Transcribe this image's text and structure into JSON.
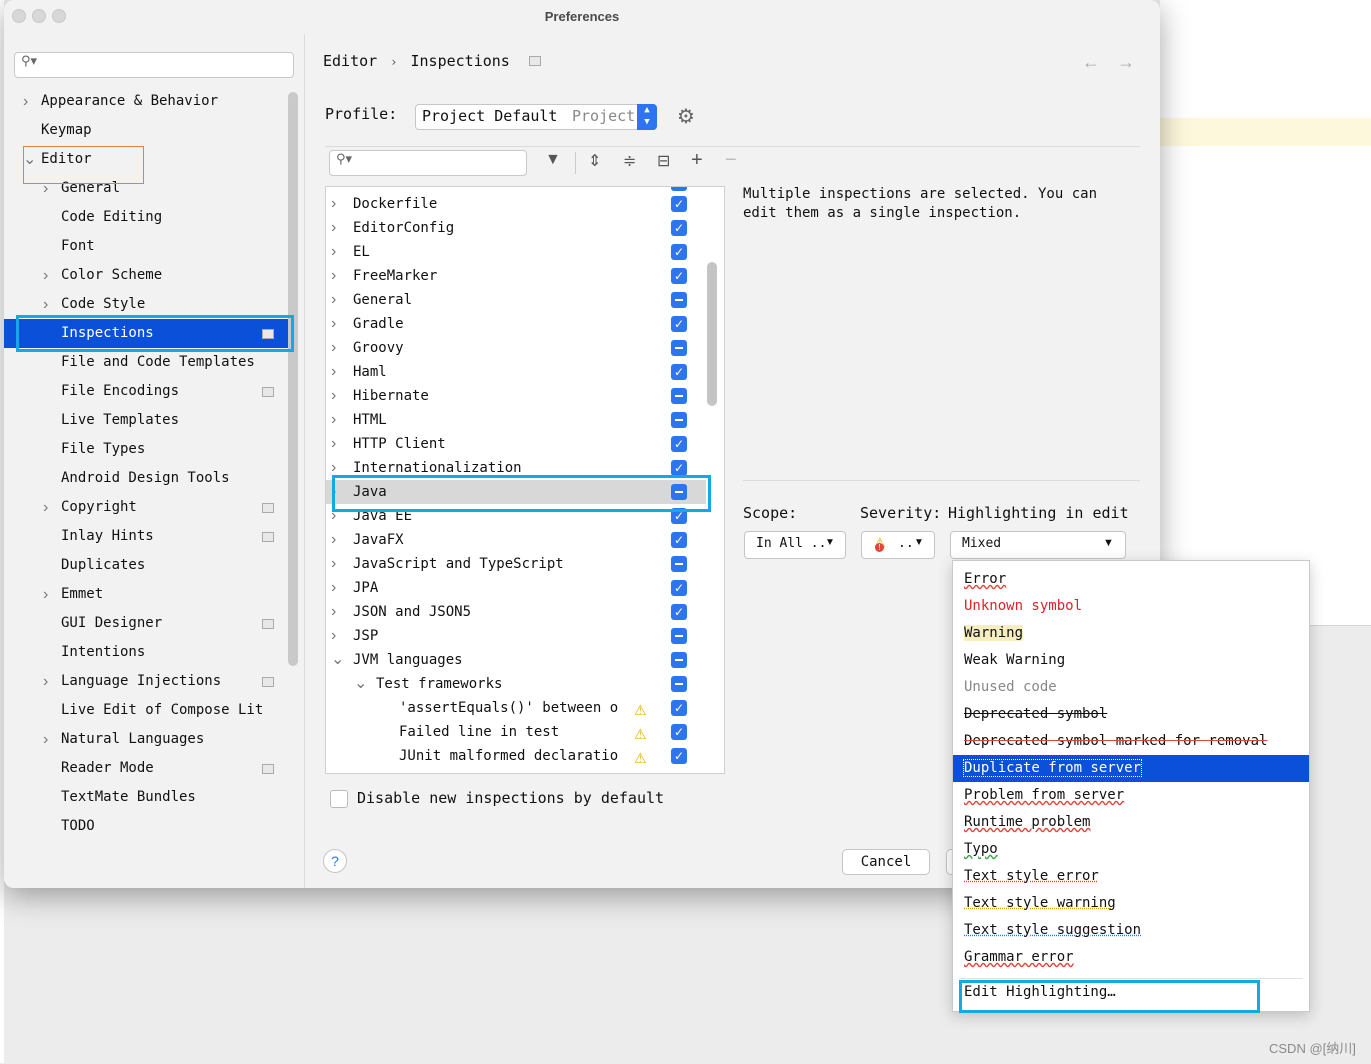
{
  "window": {
    "title": "Preferences"
  },
  "sidebar": {
    "search_placeholder": "",
    "items": [
      {
        "label": "Appearance & Behavior",
        "level": 0,
        "expandable": true
      },
      {
        "label": "Keymap",
        "level": 0,
        "expandable": false
      },
      {
        "label": "Editor",
        "level": 0,
        "expandable": true,
        "expanded": true
      },
      {
        "label": "General",
        "level": 1,
        "expandable": true
      },
      {
        "label": "Code Editing",
        "level": 1,
        "expandable": false
      },
      {
        "label": "Font",
        "level": 1,
        "expandable": false
      },
      {
        "label": "Color Scheme",
        "level": 1,
        "expandable": true
      },
      {
        "label": "Code Style",
        "level": 1,
        "expandable": true
      },
      {
        "label": "Inspections",
        "level": 1,
        "expandable": false,
        "selected": true,
        "project_icon": true
      },
      {
        "label": "File and Code Templates",
        "level": 1,
        "expandable": false
      },
      {
        "label": "File Encodings",
        "level": 1,
        "expandable": false,
        "project_icon": true
      },
      {
        "label": "Live Templates",
        "level": 1,
        "expandable": false
      },
      {
        "label": "File Types",
        "level": 1,
        "expandable": false
      },
      {
        "label": "Android Design Tools",
        "level": 1,
        "expandable": false
      },
      {
        "label": "Copyright",
        "level": 1,
        "expandable": true,
        "project_icon": true
      },
      {
        "label": "Inlay Hints",
        "level": 1,
        "expandable": false,
        "project_icon": true
      },
      {
        "label": "Duplicates",
        "level": 1,
        "expandable": false
      },
      {
        "label": "Emmet",
        "level": 1,
        "expandable": true
      },
      {
        "label": "GUI Designer",
        "level": 1,
        "expandable": false,
        "project_icon": true
      },
      {
        "label": "Intentions",
        "level": 1,
        "expandable": false
      },
      {
        "label": "Language Injections",
        "level": 1,
        "expandable": true,
        "project_icon": true
      },
      {
        "label": "Live Edit of Compose Lit",
        "level": 1,
        "expandable": false
      },
      {
        "label": "Natural Languages",
        "level": 1,
        "expandable": true
      },
      {
        "label": "Reader Mode",
        "level": 1,
        "expandable": false,
        "project_icon": true
      },
      {
        "label": "TextMate Bundles",
        "level": 1,
        "expandable": false
      },
      {
        "label": "TODO",
        "level": 1,
        "expandable": false
      }
    ]
  },
  "breadcrumb": {
    "part1": "Editor",
    "separator": "›",
    "part2": "Inspections"
  },
  "profile": {
    "label": "Profile:",
    "value": "Project Default",
    "scope_hint": "Project"
  },
  "inspections": [
    {
      "label": "Dockerfile",
      "state": "checked",
      "level": 0,
      "expandable": true
    },
    {
      "label": "EditorConfig",
      "state": "checked",
      "level": 0,
      "expandable": true
    },
    {
      "label": "EL",
      "state": "checked",
      "level": 0,
      "expandable": true
    },
    {
      "label": "FreeMarker",
      "state": "checked",
      "level": 0,
      "expandable": true
    },
    {
      "label": "General",
      "state": "partial",
      "level": 0,
      "expandable": true
    },
    {
      "label": "Gradle",
      "state": "checked",
      "level": 0,
      "expandable": true
    },
    {
      "label": "Groovy",
      "state": "partial",
      "level": 0,
      "expandable": true
    },
    {
      "label": "Haml",
      "state": "checked",
      "level": 0,
      "expandable": true
    },
    {
      "label": "Hibernate",
      "state": "partial",
      "level": 0,
      "expandable": true
    },
    {
      "label": "HTML",
      "state": "partial",
      "level": 0,
      "expandable": true
    },
    {
      "label": "HTTP Client",
      "state": "checked",
      "level": 0,
      "expandable": true
    },
    {
      "label": "Internationalization",
      "state": "checked",
      "level": 0,
      "expandable": true
    },
    {
      "label": "Java",
      "state": "partial",
      "level": 0,
      "expandable": true,
      "selected": true
    },
    {
      "label": "Java EE",
      "state": "checked",
      "level": 0,
      "expandable": true
    },
    {
      "label": "JavaFX",
      "state": "checked",
      "level": 0,
      "expandable": true
    },
    {
      "label": "JavaScript and TypeScript",
      "state": "partial",
      "level": 0,
      "expandable": true
    },
    {
      "label": "JPA",
      "state": "checked",
      "level": 0,
      "expandable": true
    },
    {
      "label": "JSON and JSON5",
      "state": "checked",
      "level": 0,
      "expandable": true
    },
    {
      "label": "JSP",
      "state": "partial",
      "level": 0,
      "expandable": true
    },
    {
      "label": "JVM languages",
      "state": "partial",
      "level": 0,
      "expandable": true,
      "expanded": true
    },
    {
      "label": "Test frameworks",
      "state": "partial",
      "level": 1,
      "expandable": true,
      "expanded": true
    },
    {
      "label": "'assertEquals()' between o",
      "state": "checked",
      "level": 2,
      "expandable": false,
      "warning": true
    },
    {
      "label": "Failed line in test",
      "state": "checked",
      "level": 2,
      "expandable": false,
      "warning": true
    },
    {
      "label": "JUnit malformed declaratio",
      "state": "checked",
      "level": 2,
      "expandable": false,
      "warning": true
    }
  ],
  "disable_new_label": "Disable new inspections by default",
  "description": {
    "line1": "Multiple inspections are selected. You can",
    "line2": "edit them as a single inspection."
  },
  "scope": {
    "label": "Scope:",
    "value": "In All .."
  },
  "severity": {
    "label": "Severity:",
    "value": ".."
  },
  "highlighting": {
    "label": "Highlighting in edito",
    "value": "Mixed"
  },
  "highlight_options": [
    {
      "label": "Error",
      "style": "error"
    },
    {
      "label": "Unknown symbol",
      "style": "unknown"
    },
    {
      "label": "Warning",
      "style": "warning"
    },
    {
      "label": "Weak Warning",
      "style": "weak"
    },
    {
      "label": "Unused code",
      "style": "unused"
    },
    {
      "label": "Deprecated symbol",
      "style": "deprecated"
    },
    {
      "label": "Deprecated symbol marked for removal",
      "style": "removal"
    },
    {
      "label": "Duplicate from server",
      "style": "selected"
    },
    {
      "label": "Problem from server",
      "style": "server"
    },
    {
      "label": "Runtime problem",
      "style": "runtime"
    },
    {
      "label": "Typo",
      "style": "typo"
    },
    {
      "label": "Text style error",
      "style": "tserr"
    },
    {
      "label": "Text style warning",
      "style": "tswarn"
    },
    {
      "label": "Text style suggestion",
      "style": "tssug"
    },
    {
      "label": "Grammar error",
      "style": "grammar"
    }
  ],
  "edit_highlighting": "Edit Highlighting…",
  "buttons": {
    "cancel": "Cancel",
    "help": "?"
  },
  "watermark": "CSDN @[纳川]",
  "colors": {
    "accent": "#2d75f0",
    "selection": "#0b50d9",
    "callout": "#14a8e6",
    "editor_highlight": "#e8823a"
  }
}
